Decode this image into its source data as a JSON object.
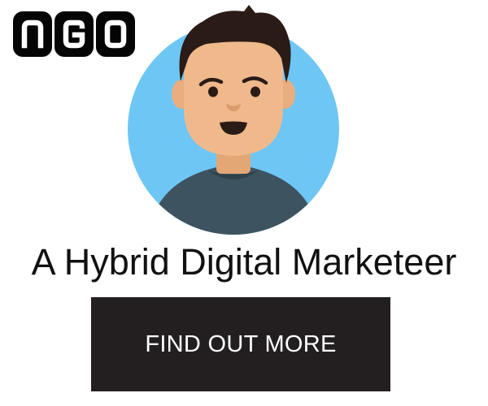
{
  "logo": {
    "letters": [
      "N",
      "G",
      "O"
    ],
    "tile_color": "#050505",
    "letter_color": "#ffffff"
  },
  "avatar": {
    "icon": "person-avatar-icon",
    "background_color": "#6ec6f5",
    "skin_color": "#f0b98b",
    "hair_color": "#2b1b17",
    "shirt_color": "#3d5360"
  },
  "hero": {
    "headline": "A Hybrid Digital Marketeer",
    "cta_label": "FIND OUT MORE",
    "cta_color": "#231f20"
  }
}
